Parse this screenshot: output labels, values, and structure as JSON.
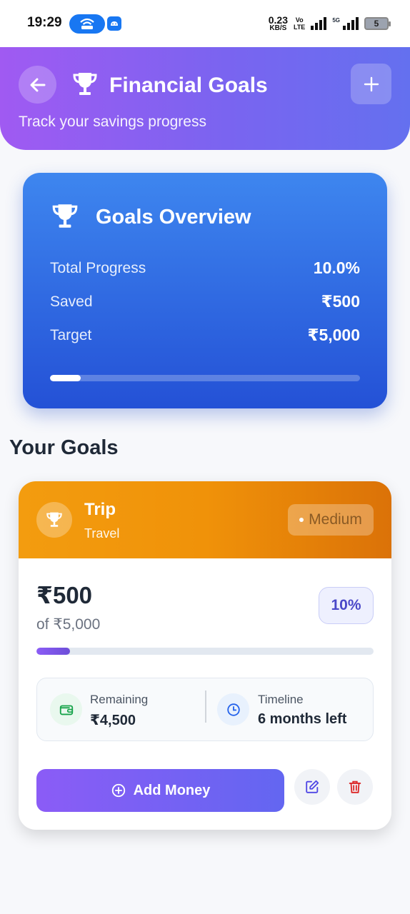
{
  "status_bar": {
    "time": "19:29",
    "speed_value": "0.23",
    "speed_unit": "KB/S",
    "volte_top": "Vo",
    "volte_bottom": "LTE",
    "network": "5G",
    "battery": "5"
  },
  "header": {
    "title": "Financial Goals",
    "subtitle": "Track your savings progress",
    "back_icon": "arrow-left-icon",
    "add_icon": "plus-icon",
    "title_icon": "trophy-icon"
  },
  "overview": {
    "title": "Goals Overview",
    "rows": [
      {
        "label": "Total Progress",
        "value": "10.0%"
      },
      {
        "label": "Saved",
        "value": "₹500"
      },
      {
        "label": "Target",
        "value": "₹5,000"
      }
    ],
    "progress_fraction": 0.1
  },
  "goals_section": {
    "title": "Your Goals"
  },
  "goals": [
    {
      "name": "Trip",
      "category": "Travel",
      "priority": "Medium",
      "saved": "₹500",
      "of_text": "of ₹5,000",
      "percent": "10%",
      "progress_fraction": 0.1,
      "remaining_label": "Remaining",
      "remaining_value": "₹4,500",
      "timeline_label": "Timeline",
      "timeline_value": "6 months left",
      "add_money_label": "Add Money"
    }
  ],
  "colors": {
    "header_gradient_start": "#a05af2",
    "header_gradient_end": "#6470ef",
    "overview_start": "#3e86ef",
    "overview_end": "#2451d6",
    "goal_header": "#f39c0f",
    "accent_purple": "#8b5cf6",
    "delete_red": "#dc2626"
  }
}
